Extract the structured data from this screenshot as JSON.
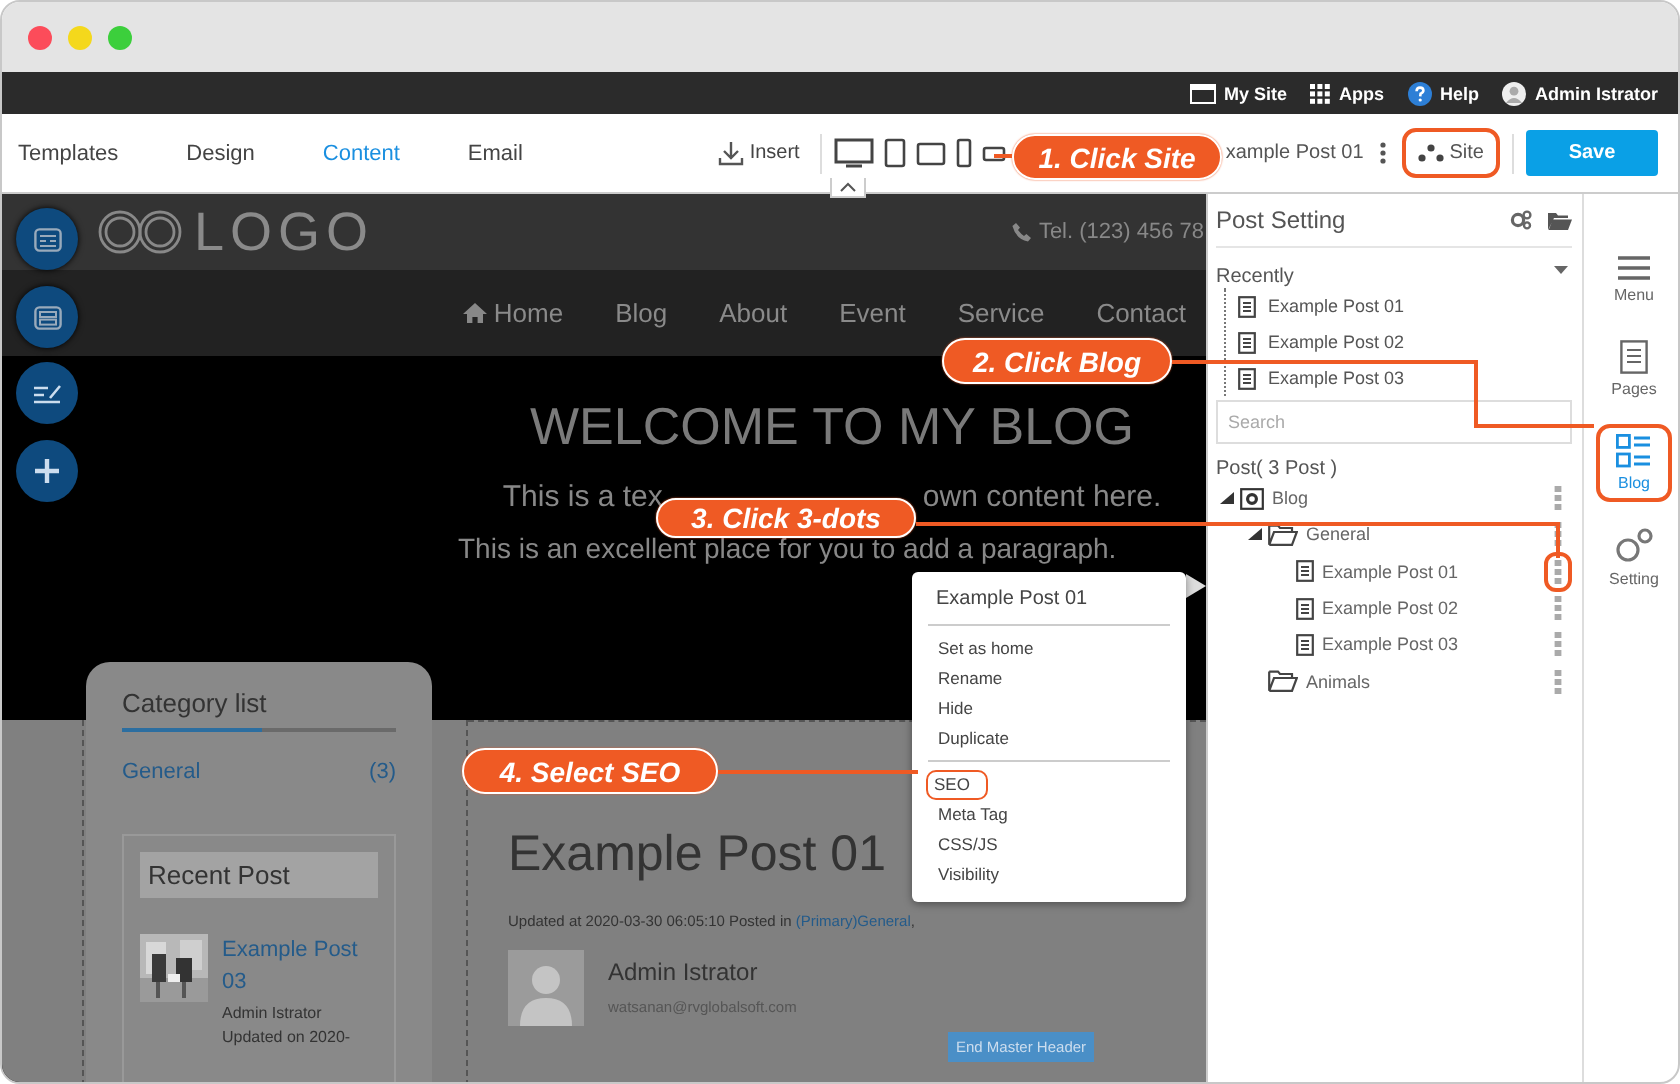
{
  "admin_bar": {
    "links": [
      {
        "label": "My Site"
      },
      {
        "label": "Apps"
      },
      {
        "label": "Help"
      }
    ],
    "user": "Admin Istrator"
  },
  "toolbar": {
    "tabs": [
      {
        "label": "Templates",
        "selected": false
      },
      {
        "label": "Design",
        "selected": false
      },
      {
        "label": "Content",
        "selected": true
      },
      {
        "label": "Email",
        "selected": false
      }
    ],
    "insert": "Insert",
    "page": "xample Post 01",
    "site": {
      "label": "Site",
      "highlighted": true
    },
    "save": "Save"
  },
  "site": {
    "logo": "LOGO",
    "phone": "Tel. (123) 456 78",
    "nav": [
      {
        "label": "Home"
      },
      {
        "label": "Blog"
      },
      {
        "label": "About"
      },
      {
        "label": "Event"
      },
      {
        "label": "Service"
      },
      {
        "label": "Contact"
      }
    ],
    "hero": {
      "title": "WELCOME TO MY BLOG",
      "line_1": [
        "This is a tex",
        "own content here."
      ],
      "line_2": "This is an excellent place for you to add a paragraph."
    },
    "card": {
      "title": "Category list",
      "categories": [
        {
          "name": "General",
          "count": "(3)"
        }
      ],
      "recent_title": "Recent Post",
      "recent": {
        "title": "Example Post 03",
        "author": "Admin Istrator",
        "updated": "Updated on 2020-"
      }
    },
    "post": {
      "title": "Example Post 01",
      "meta": "Updated at 2020-03-30 06:05:10 Posted in ",
      "category": "(Primary)General",
      "meta_end": ",",
      "author": "Admin Istrator",
      "email": "watsanan@rvglobalsoft.com",
      "badge": "End Master Header"
    }
  },
  "context_menu": {
    "title": "Example Post 01",
    "groups": [
      [
        {
          "label": "Set as home",
          "highlighted": false
        },
        {
          "label": "Rename",
          "highlighted": false
        },
        {
          "label": "Hide",
          "highlighted": false
        },
        {
          "label": "Duplicate",
          "highlighted": false
        }
      ],
      [
        {
          "label": "SEO",
          "highlighted": true
        },
        {
          "label": "Meta Tag",
          "highlighted": false
        },
        {
          "label": "CSS/JS",
          "highlighted": false
        },
        {
          "label": "Visibility",
          "highlighted": false
        }
      ]
    ]
  },
  "post_panel": {
    "title": "Post Setting",
    "recent_label": "Recently",
    "recent": [
      "Example Post 01",
      "Example Post 02",
      "Example Post 03"
    ],
    "search": {
      "placeholder": "Search"
    },
    "posts_label": "Post( 3 Post )",
    "tree": [
      {
        "label": "Blog",
        "kind": "blog",
        "highlighted": false,
        "children": [
          {
            "label": "General",
            "kind": "folder",
            "highlighted": false,
            "children": [
              {
                "label": "Example Post 01",
                "kind": "post",
                "highlighted": true
              },
              {
                "label": "Example Post 02",
                "kind": "post",
                "highlighted": false
              },
              {
                "label": "Example Post 03",
                "kind": "post",
                "highlighted": false
              }
            ]
          },
          {
            "label": "Animals",
            "kind": "folder",
            "highlighted": false
          }
        ]
      }
    ]
  },
  "sidebar": [
    {
      "label": "Menu",
      "selected": false,
      "highlighted": false
    },
    {
      "label": "Pages",
      "selected": false,
      "highlighted": false
    },
    {
      "label": "Blog",
      "selected": true,
      "highlighted": true
    },
    {
      "label": "Setting",
      "selected": false,
      "highlighted": false
    }
  ],
  "callouts": [
    {
      "label": "1. Click Site"
    },
    {
      "label": "2. Click Blog"
    },
    {
      "label": "3. Click 3-dots"
    },
    {
      "label": "4. Select SEO"
    }
  ]
}
